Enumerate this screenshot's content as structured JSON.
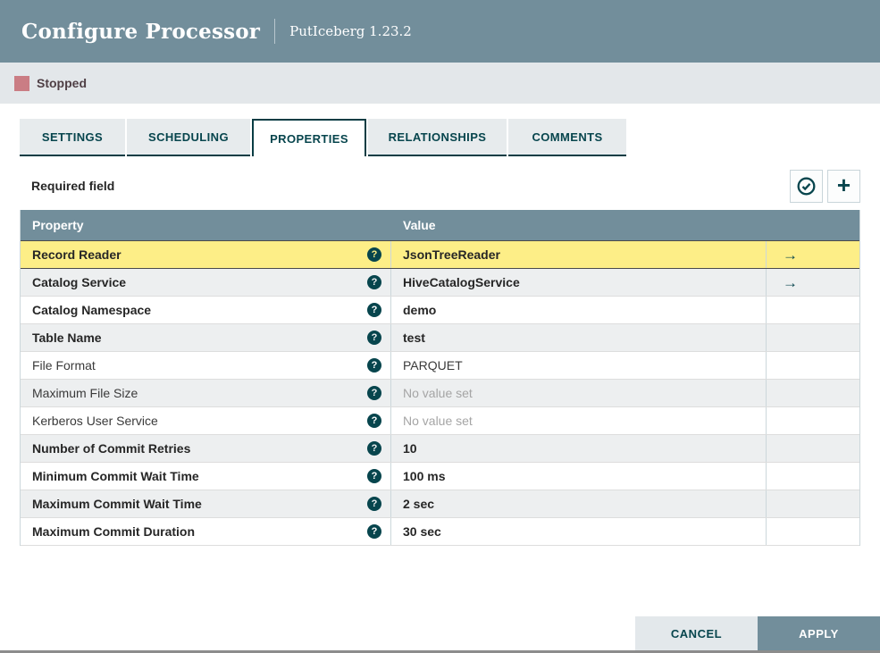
{
  "header": {
    "title": "Configure Processor",
    "subtitle": "PutIceberg 1.23.2"
  },
  "status": {
    "label": "Stopped",
    "color": "#ca7d84"
  },
  "tabs": [
    {
      "label": "SETTINGS",
      "active": false
    },
    {
      "label": "SCHEDULING",
      "active": false
    },
    {
      "label": "PROPERTIES",
      "active": true
    },
    {
      "label": "RELATIONSHIPS",
      "active": false
    },
    {
      "label": "COMMENTS",
      "active": false
    }
  ],
  "toolbar": {
    "required_label": "Required field",
    "buttons": [
      {
        "name": "verify-properties",
        "icon": "check-circle-icon"
      },
      {
        "name": "add-property",
        "icon": "plus-icon"
      }
    ]
  },
  "table": {
    "columns": [
      "Property",
      "Value"
    ],
    "rows": [
      {
        "property": "Record Reader",
        "required": true,
        "value": "JsonTreeReader",
        "value_set": true,
        "has_link": true,
        "selected": true
      },
      {
        "property": "Catalog Service",
        "required": true,
        "value": "HiveCatalogService",
        "value_set": true,
        "has_link": true,
        "selected": false
      },
      {
        "property": "Catalog Namespace",
        "required": true,
        "value": "demo",
        "value_set": true,
        "has_link": false,
        "selected": false
      },
      {
        "property": "Table Name",
        "required": true,
        "value": "test",
        "value_set": true,
        "has_link": false,
        "selected": false
      },
      {
        "property": "File Format",
        "required": false,
        "value": "PARQUET",
        "value_set": true,
        "has_link": false,
        "selected": false
      },
      {
        "property": "Maximum File Size",
        "required": false,
        "value": "No value set",
        "value_set": false,
        "has_link": false,
        "selected": false
      },
      {
        "property": "Kerberos User Service",
        "required": false,
        "value": "No value set",
        "value_set": false,
        "has_link": false,
        "selected": false
      },
      {
        "property": "Number of Commit Retries",
        "required": true,
        "value": "10",
        "value_set": true,
        "has_link": false,
        "selected": false
      },
      {
        "property": "Minimum Commit Wait Time",
        "required": true,
        "value": "100 ms",
        "value_set": true,
        "has_link": false,
        "selected": false
      },
      {
        "property": "Maximum Commit Wait Time",
        "required": true,
        "value": "2 sec",
        "value_set": true,
        "has_link": false,
        "selected": false
      },
      {
        "property": "Maximum Commit Duration",
        "required": true,
        "value": "30 sec",
        "value_set": true,
        "has_link": false,
        "selected": false
      }
    ]
  },
  "footer": {
    "cancel_label": "CANCEL",
    "apply_label": "APPLY"
  },
  "colors": {
    "header_bg": "#728e9b",
    "accent_teal": "#07454d",
    "selected_row": "#fdee87",
    "status_bg": "#e3e7ea"
  }
}
